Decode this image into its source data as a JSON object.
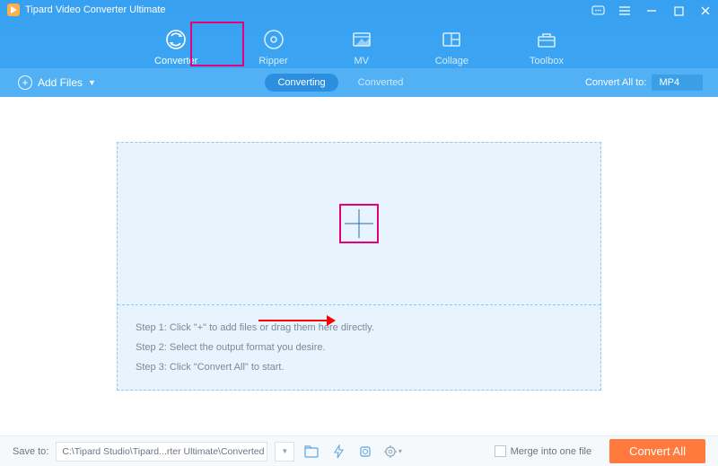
{
  "app": {
    "title": "Tipard Video Converter Ultimate"
  },
  "tabs": [
    {
      "id": "converter",
      "label": "Converter",
      "active": true
    },
    {
      "id": "ripper",
      "label": "Ripper"
    },
    {
      "id": "mv",
      "label": "MV"
    },
    {
      "id": "collage",
      "label": "Collage"
    },
    {
      "id": "toolbox",
      "label": "Toolbox"
    }
  ],
  "toolbar": {
    "add_files": "Add Files",
    "converting": "Converting",
    "converted": "Converted",
    "convert_all_to": "Convert All to:",
    "format": "MP4"
  },
  "steps": {
    "s1": "Step 1: Click \"+\" to add files or drag them here directly.",
    "s2": "Step 2: Select the output format you desire.",
    "s3": "Step 3: Click \"Convert All\" to start."
  },
  "footer": {
    "save_to_label": "Save to:",
    "path": "C:\\Tipard Studio\\Tipard...rter Ultimate\\Converted",
    "merge_label": "Merge into one file",
    "convert_all": "Convert All"
  }
}
